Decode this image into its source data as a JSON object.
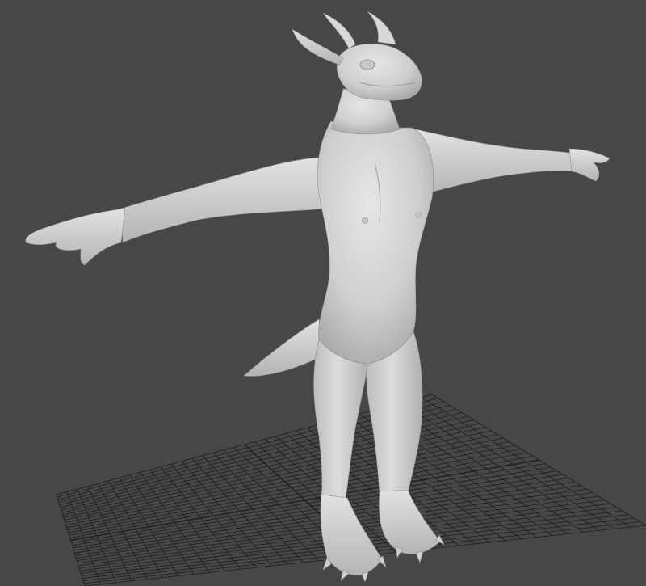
{
  "viewport": {
    "background_color": "#474747",
    "grid_line_color": "#1f1f1f",
    "model_color": "#d3d3d3",
    "model_shadow_color": "#9a9a9a",
    "shading": "smooth-shaded",
    "projection": "perspective",
    "grid_visible": true
  },
  "scene": {
    "object": "humanoid-dragon-sculpt",
    "pose": "t-pose",
    "features": [
      "horns",
      "ears",
      "tail",
      "clawed-hands",
      "clawed-feet"
    ]
  }
}
